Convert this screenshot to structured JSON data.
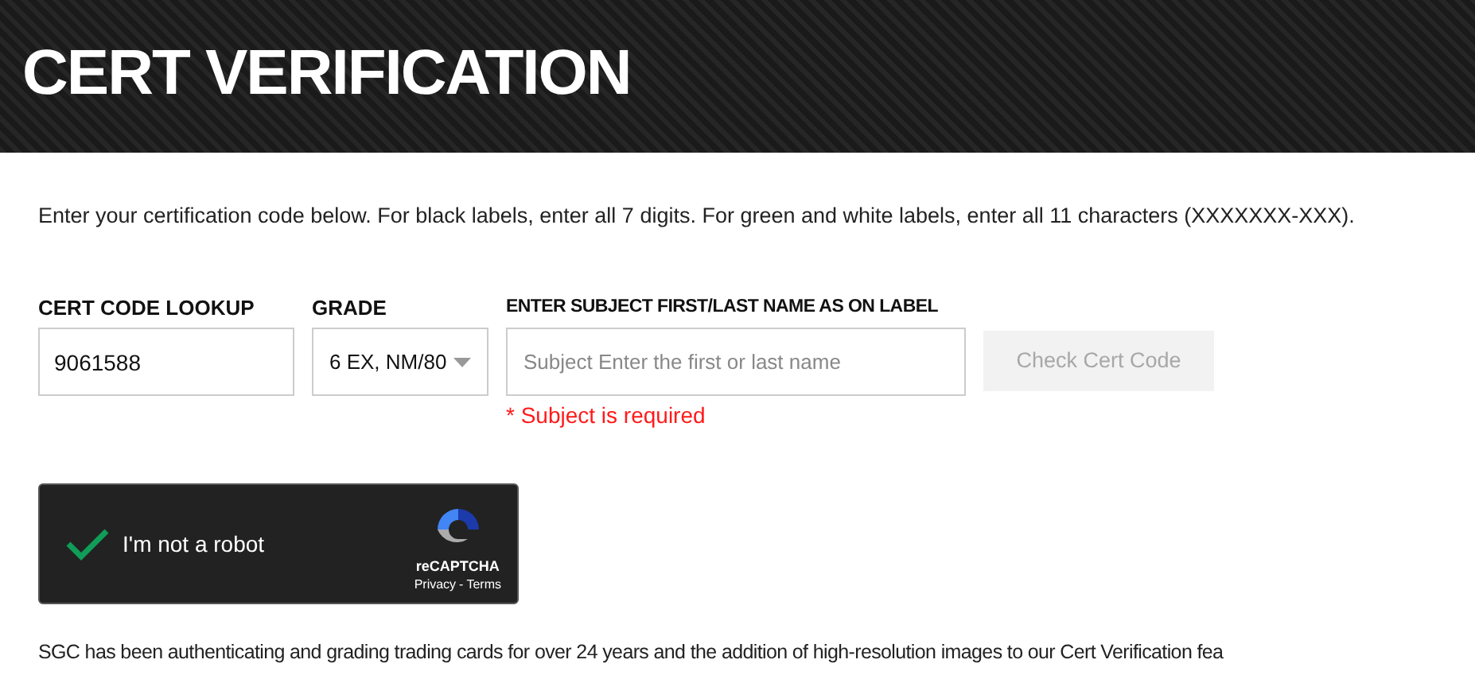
{
  "header": {
    "title": "CERT VERIFICATION"
  },
  "intro": "Enter your certification code below. For black labels, enter all 7 digits. For green and white labels, enter all 11 characters (XXXXXXX-XXX).",
  "form": {
    "cert_code": {
      "label": "CERT CODE LOOKUP",
      "value": "9061588"
    },
    "grade": {
      "label": "GRADE",
      "value": "6 EX, NM/80"
    },
    "subject": {
      "label": "ENTER SUBJECT FIRST/LAST NAME AS ON LABEL",
      "placeholder": "Subject Enter the first or last name",
      "error": "* Subject is required"
    },
    "submit": {
      "label": "Check Cert Code",
      "disabled": true
    }
  },
  "captcha": {
    "label": "I'm not a robot",
    "checked": true,
    "brand": "reCAPTCHA",
    "links": [
      "Privacy",
      "-",
      "Terms"
    ]
  },
  "footer_text": "SGC has been authenticating and grading trading cards for over 24 years and the addition of high-resolution images to our Cert Verification fea"
}
